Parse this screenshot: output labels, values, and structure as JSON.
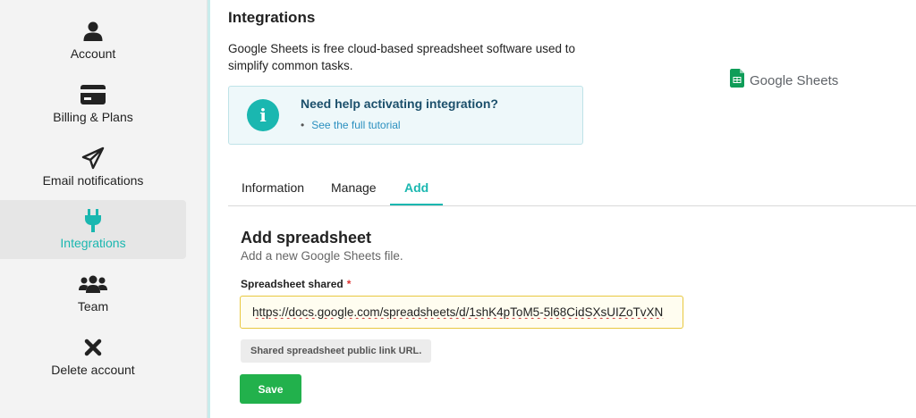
{
  "sidebar": {
    "items": [
      {
        "label": "Account",
        "icon": "user-icon"
      },
      {
        "label": "Billing & Plans",
        "icon": "credit-card-icon"
      },
      {
        "label": "Email notifications",
        "icon": "paper-plane-icon"
      },
      {
        "label": "Integrations",
        "icon": "plug-icon",
        "active": true
      },
      {
        "label": "Team",
        "icon": "users-icon"
      },
      {
        "label": "Delete account",
        "icon": "close-icon"
      }
    ]
  },
  "main": {
    "title": "Integrations",
    "description": "Google Sheets is free cloud-based spreadsheet software used to simplify common tasks.",
    "logo_label": "Google Sheets",
    "help": {
      "title": "Need help activating integration?",
      "link": "See the full tutorial"
    },
    "tabs": [
      {
        "label": "Information"
      },
      {
        "label": "Manage"
      },
      {
        "label": "Add",
        "active": true
      }
    ],
    "form": {
      "title": "Add spreadsheet",
      "subtitle": "Add a new Google Sheets file.",
      "field_label": "Spreadsheet shared",
      "required_mark": "*",
      "url_value": "https://docs.google.com/spreadsheets/d/1shK4pToM5-5l68CidSXsUIZoTvXN",
      "hint": "Shared spreadsheet public link URL.",
      "save_label": "Save"
    }
  },
  "colors": {
    "accent": "#1ab7b0",
    "save_button": "#22b14c",
    "help_title": "#1b4f6b",
    "input_border": "#e8c840"
  }
}
